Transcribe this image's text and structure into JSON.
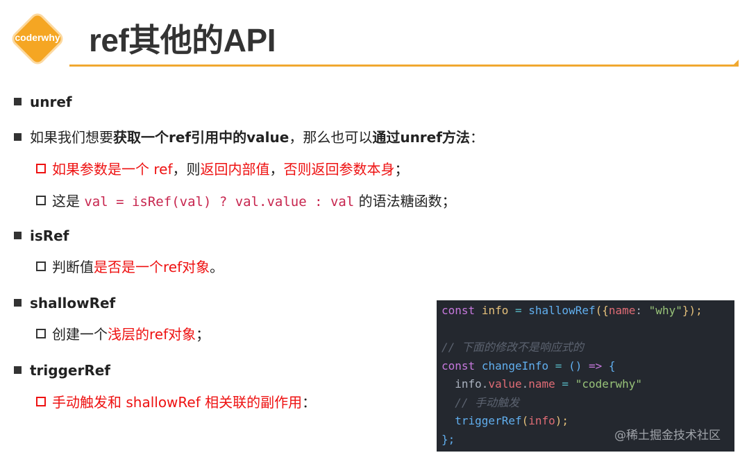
{
  "logo": {
    "text": "coderwhy"
  },
  "title": "ref其他的API",
  "bullets": {
    "unref": {
      "label": "unref"
    },
    "line2": {
      "p1": "如果我们想要",
      "p2": "获取一个ref引用中的value",
      "p3": "，那么也可以",
      "p4": "通过unref方法",
      "p5": "："
    },
    "line3": {
      "p1": "如果参数是一个 ref",
      "p2": "，则",
      "p3": "返回内部值",
      "p4": "，",
      "p5": "否则返回参数本身",
      "p6": "；"
    },
    "line4": {
      "p1": "这是 ",
      "code": "val = isRef(val) ? val.value : val",
      "p2": " 的语法糖函数；"
    },
    "isref": {
      "label": "isRef"
    },
    "line6": {
      "p1": "判断值",
      "p2": "是否是一个ref对象",
      "p3": "。"
    },
    "shallowref": {
      "label": "shallowRef"
    },
    "line8": {
      "p1": "创建一个",
      "p2": "浅层的ref对象",
      "p3": "；"
    },
    "triggerref": {
      "label": "triggerRef"
    },
    "line10": {
      "p1": "手动触发和 shallowRef 相关联的副作用",
      "p2": "："
    }
  },
  "code": {
    "l1": {
      "kw": "const",
      "var": "info",
      "eq": "=",
      "fn": "shallowRef",
      "open": "({",
      "prop": "name",
      "colon": ":",
      "str": "\"why\"",
      "close": "});"
    },
    "l3": {
      "comment": "// 下面的修改不是响应式的"
    },
    "l4": {
      "kw": "const",
      "fn": "changeInfo",
      "eq": "=",
      "paren": "()",
      "arrow": "=>",
      "brace": "{"
    },
    "l5": {
      "var": "info",
      "dot1": ".",
      "prop1": "value",
      "dot2": ".",
      "prop2": "name",
      "eq": "=",
      "str": "\"coderwhy\""
    },
    "l6": {
      "comment": "// 手动触发"
    },
    "l7": {
      "fn": "triggerRef",
      "open": "(",
      "var": "info",
      "close": ");"
    },
    "l8": {
      "close": "};"
    }
  },
  "watermark": "@稀土掘金技术社区",
  "colors": {
    "accent": "#f0a830",
    "red": "#ee1111",
    "code_bg": "#24282f"
  }
}
